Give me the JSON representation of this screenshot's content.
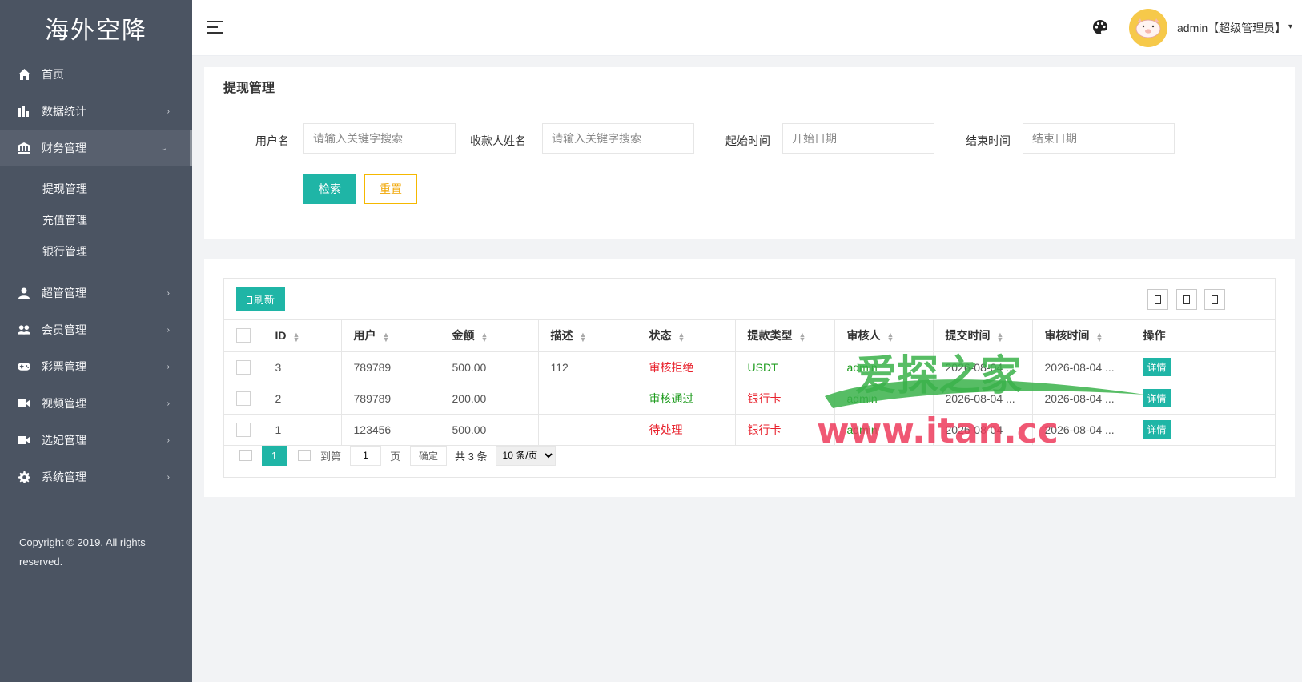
{
  "brand": "海外空降",
  "sidebar": {
    "items": [
      {
        "label": "首页",
        "icon": "home-icon"
      },
      {
        "label": "数据统计",
        "icon": "bar-chart-icon",
        "arrow": "›"
      },
      {
        "label": "财务管理",
        "icon": "bank-icon",
        "arrow": "⌄"
      },
      {
        "label": "超管管理",
        "icon": "user-icon",
        "arrow": "›"
      },
      {
        "label": "会员管理",
        "icon": "users-icon",
        "arrow": "›"
      },
      {
        "label": "彩票管理",
        "icon": "gamepad-icon",
        "arrow": "›"
      },
      {
        "label": "视频管理",
        "icon": "video-icon",
        "arrow": "›"
      },
      {
        "label": "选妃管理",
        "icon": "camera-icon",
        "arrow": "›"
      },
      {
        "label": "系统管理",
        "icon": "gear-icon",
        "arrow": "›"
      }
    ],
    "submenu": [
      "提现管理",
      "充值管理",
      "银行管理"
    ],
    "copyright": "Copyright © 2019. All rights reserved."
  },
  "header": {
    "user": "admin【超级管理员】",
    "caret": "▾"
  },
  "search": {
    "title": "提现管理",
    "fields": [
      {
        "label": "用户名",
        "placeholder": "请输入关键字搜索"
      },
      {
        "label": "收款人姓名",
        "placeholder": "请输入关键字搜索"
      },
      {
        "label": "起始时间",
        "placeholder": "开始日期"
      },
      {
        "label": "结束时间",
        "placeholder": "结束日期"
      }
    ],
    "search_label": "检索",
    "reset_label": "重置"
  },
  "table": {
    "refresh_label": "刷新",
    "columns": [
      "ID",
      "用户",
      "金额",
      "描述",
      "状态",
      "提款类型",
      "审核人",
      "提交时间",
      "审核时间",
      "操作"
    ],
    "rows": [
      {
        "id": "3",
        "user": "789789",
        "amount": "500.00",
        "desc": "112",
        "status": "审核拒绝",
        "status_color": "red",
        "type": "USDT",
        "type_color": "green",
        "reviewer": "admin",
        "submit_time": "2026-08-04 ...",
        "review_time": "2026-08-04 ...",
        "action": "详情"
      },
      {
        "id": "2",
        "user": "789789",
        "amount": "200.00",
        "desc": "",
        "status": "审核通过",
        "status_color": "green",
        "type": "银行卡",
        "type_color": "red",
        "reviewer": "admin",
        "submit_time": "2026-08-04 ...",
        "review_time": "2026-08-04 ...",
        "action": "详情"
      },
      {
        "id": "1",
        "user": "123456",
        "amount": "500.00",
        "desc": "",
        "status": "待处理",
        "status_color": "red",
        "type": "银行卡",
        "type_color": "red",
        "reviewer": "admin",
        "submit_time": "2026-08-04",
        "review_time": "2026-08-04 ...",
        "action": "详情"
      }
    ],
    "pager": {
      "current": "1",
      "goto_label": "到第",
      "goto_value": "1",
      "page_label": "页",
      "confirm_label": "确定",
      "total": "共 3 条",
      "per_page": "10 条/页"
    }
  },
  "watermark": {
    "line1": "爱探之家",
    "line2": "www.itan.cc"
  },
  "colors": {
    "sidebar_bg": "#4b5462",
    "accent": "#1fb5a6",
    "reset_border": "#f5b800",
    "status_red": "#e8222d",
    "status_green": "#1d9b1d"
  }
}
